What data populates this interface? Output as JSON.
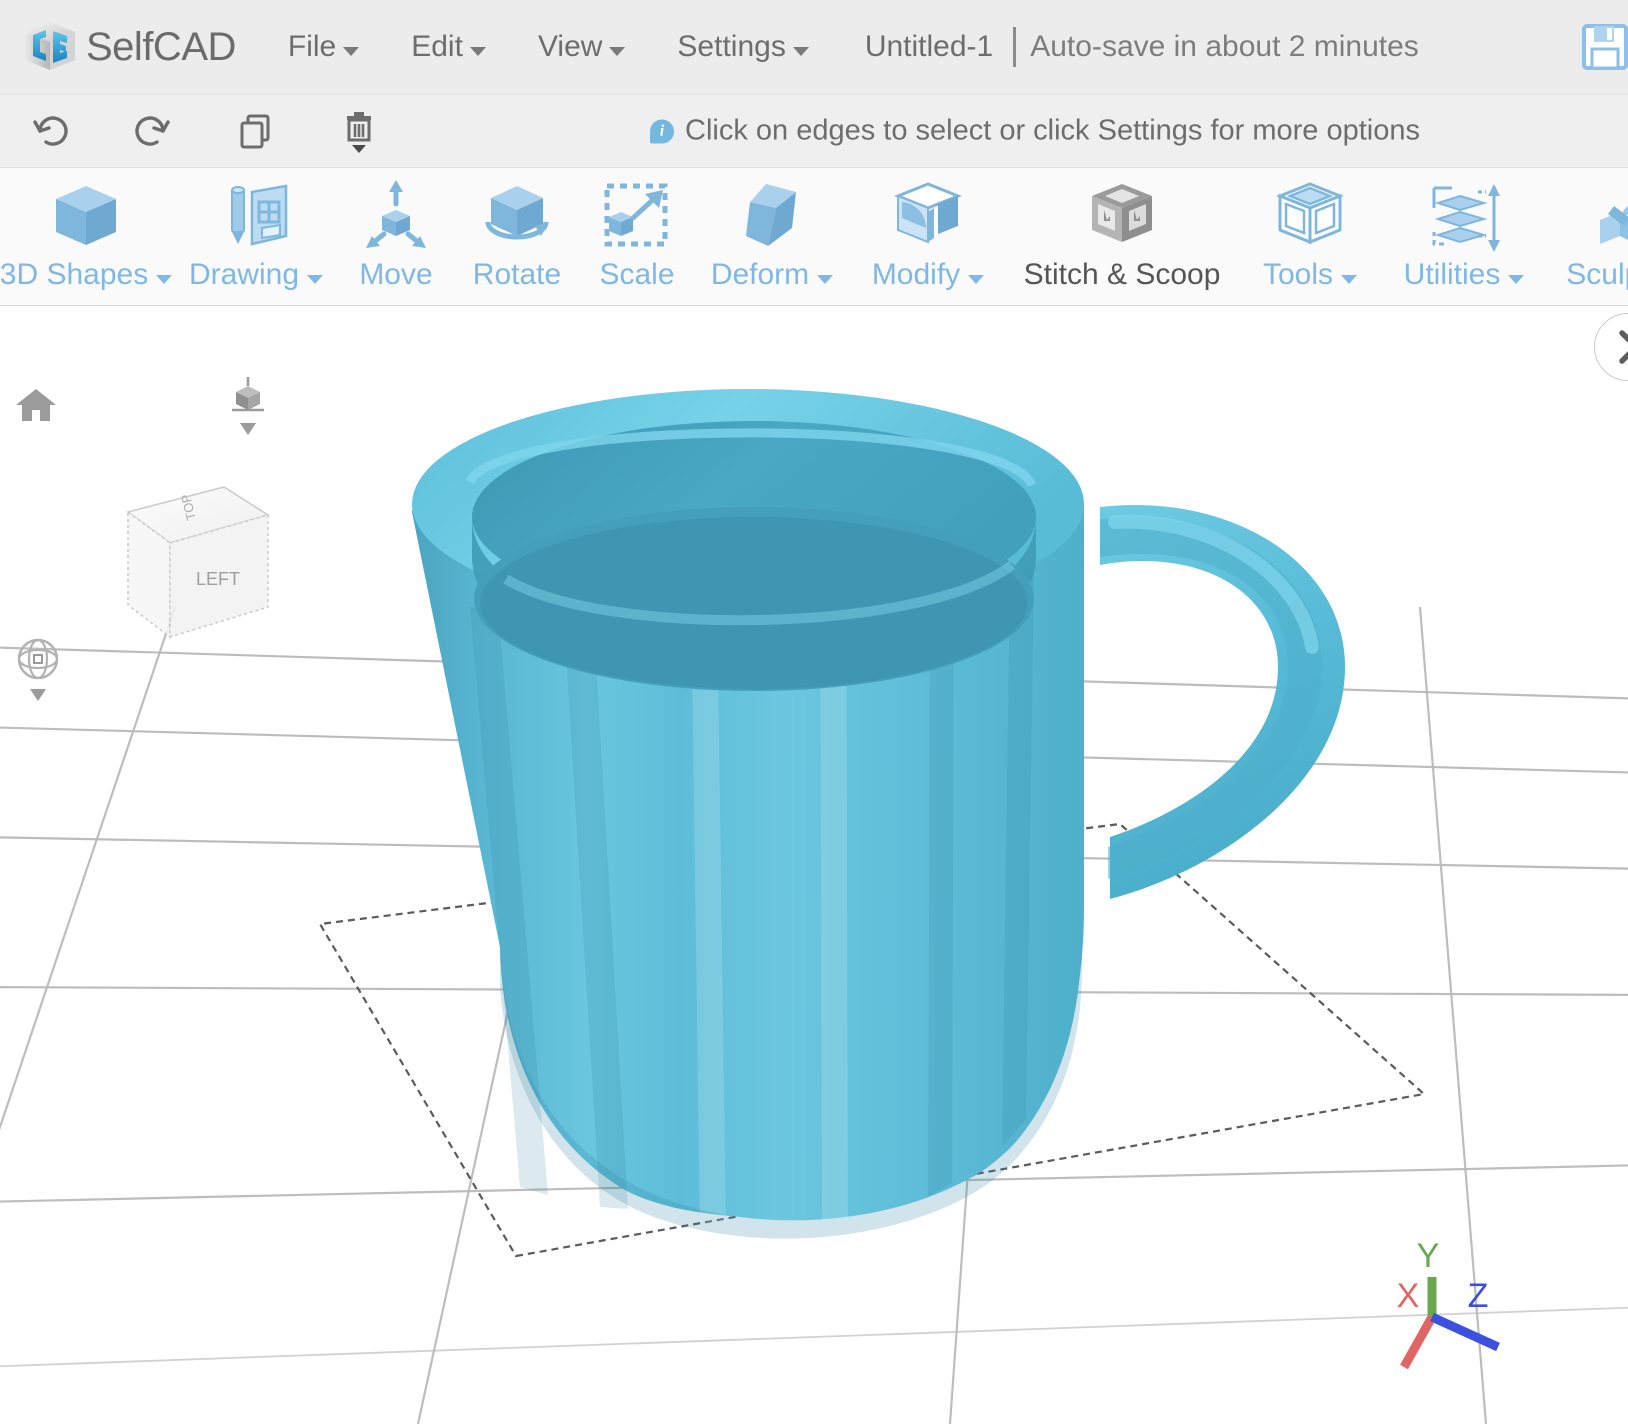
{
  "app": {
    "name": "SelfCAD",
    "logo_icon": "selfcad-cube-logo"
  },
  "menubar": {
    "items": [
      {
        "label": "File",
        "has_dropdown": true
      },
      {
        "label": "Edit",
        "has_dropdown": true
      },
      {
        "label": "View",
        "has_dropdown": true
      },
      {
        "label": "Settings",
        "has_dropdown": true
      }
    ],
    "document_title": "Untitled-1",
    "autosave_status": "Auto-save in about 2 minutes",
    "save_icon": "floppy-save-icon"
  },
  "quickbar": {
    "buttons": [
      {
        "name": "undo-button",
        "icon": "undo-arrow-icon"
      },
      {
        "name": "redo-button",
        "icon": "redo-arrow-icon"
      },
      {
        "name": "copy-button",
        "icon": "copy-pages-icon"
      },
      {
        "name": "delete-button",
        "icon": "trash-can-icon"
      }
    ],
    "hint_icon": "info-icon",
    "hint_text": "Click on edges to select or click Settings for more options"
  },
  "ribbon": {
    "tools": [
      {
        "label": "3D Shapes",
        "icon": "cube-icon",
        "has_dropdown": true,
        "disabled": false
      },
      {
        "label": "Drawing",
        "icon": "pencil-sketch-icon",
        "has_dropdown": true,
        "disabled": false
      },
      {
        "label": "Move",
        "icon": "move-arrows-icon",
        "has_dropdown": false,
        "disabled": false
      },
      {
        "label": "Rotate",
        "icon": "rotate-cube-icon",
        "has_dropdown": false,
        "disabled": false
      },
      {
        "label": "Scale",
        "icon": "scale-marquee-icon",
        "has_dropdown": false,
        "disabled": false
      },
      {
        "label": "Deform",
        "icon": "deform-skew-icon",
        "has_dropdown": true,
        "disabled": false
      },
      {
        "label": "Modify",
        "icon": "modify-cube-icon",
        "has_dropdown": true,
        "disabled": false
      },
      {
        "label": "Stitch & Scoop",
        "icon": "stitch-scoop-icon",
        "has_dropdown": false,
        "disabled": true
      },
      {
        "label": "Tools",
        "icon": "tools-cube-icon",
        "has_dropdown": true,
        "disabled": false
      },
      {
        "label": "Utilities",
        "icon": "utilities-layers-icon",
        "has_dropdown": true,
        "disabled": false
      },
      {
        "label": "Sculpting",
        "icon": "sculpting-brush-icon",
        "has_dropdown": false,
        "disabled": false
      }
    ]
  },
  "viewport": {
    "home_icon": "home-icon",
    "viewcube_gizmo_icon": "viewcube-small-icon",
    "viewcube_dropdown_icon": "chevron-down-icon",
    "orbit_icon": "orbit-target-icon",
    "orbit_dropdown_icon": "chevron-down-icon",
    "navcube": {
      "top_face_label": "TOP",
      "front_face_label": "LEFT"
    },
    "axis_gizmo": {
      "x_label": "X",
      "y_label": "Y",
      "z_label": "Z",
      "x_color": "#e06666",
      "y_color": "#6aa84f",
      "z_color": "#3c50e0"
    },
    "model": {
      "name": "coffee-mug-3d-model",
      "color": "#5cc0dc",
      "selected": true
    },
    "panel_toggle_icon": "chevron-right-icon"
  },
  "colors": {
    "accent_blue": "#7fb8e6",
    "model_cyan": "#5cc0dc",
    "menubar_bg": "#ececec",
    "quickbar_bg": "#efefef",
    "ribbon_bg": "#fafafa",
    "text_gray": "#6d6d6d"
  }
}
